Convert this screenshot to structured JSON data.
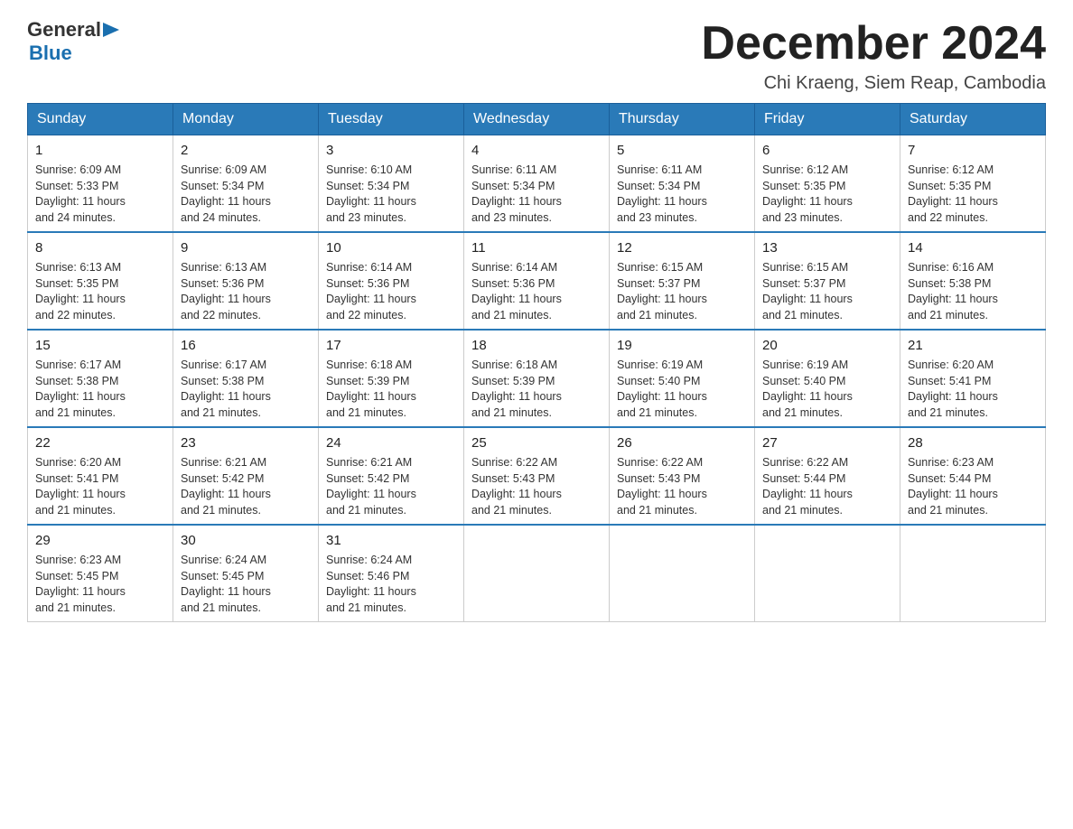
{
  "logo": {
    "general": "General",
    "blue": "Blue",
    "arrow": "▶"
  },
  "header": {
    "title": "December 2024",
    "subtitle": "Chi Kraeng, Siem Reap, Cambodia"
  },
  "days": [
    "Sunday",
    "Monday",
    "Tuesday",
    "Wednesday",
    "Thursday",
    "Friday",
    "Saturday"
  ],
  "weeks": [
    [
      {
        "date": "1",
        "sunrise": "6:09 AM",
        "sunset": "5:33 PM",
        "daylight": "11 hours and 24 minutes."
      },
      {
        "date": "2",
        "sunrise": "6:09 AM",
        "sunset": "5:34 PM",
        "daylight": "11 hours and 24 minutes."
      },
      {
        "date": "3",
        "sunrise": "6:10 AM",
        "sunset": "5:34 PM",
        "daylight": "11 hours and 23 minutes."
      },
      {
        "date": "4",
        "sunrise": "6:11 AM",
        "sunset": "5:34 PM",
        "daylight": "11 hours and 23 minutes."
      },
      {
        "date": "5",
        "sunrise": "6:11 AM",
        "sunset": "5:34 PM",
        "daylight": "11 hours and 23 minutes."
      },
      {
        "date": "6",
        "sunrise": "6:12 AM",
        "sunset": "5:35 PM",
        "daylight": "11 hours and 23 minutes."
      },
      {
        "date": "7",
        "sunrise": "6:12 AM",
        "sunset": "5:35 PM",
        "daylight": "11 hours and 22 minutes."
      }
    ],
    [
      {
        "date": "8",
        "sunrise": "6:13 AM",
        "sunset": "5:35 PM",
        "daylight": "11 hours and 22 minutes."
      },
      {
        "date": "9",
        "sunrise": "6:13 AM",
        "sunset": "5:36 PM",
        "daylight": "11 hours and 22 minutes."
      },
      {
        "date": "10",
        "sunrise": "6:14 AM",
        "sunset": "5:36 PM",
        "daylight": "11 hours and 22 minutes."
      },
      {
        "date": "11",
        "sunrise": "6:14 AM",
        "sunset": "5:36 PM",
        "daylight": "11 hours and 21 minutes."
      },
      {
        "date": "12",
        "sunrise": "6:15 AM",
        "sunset": "5:37 PM",
        "daylight": "11 hours and 21 minutes."
      },
      {
        "date": "13",
        "sunrise": "6:15 AM",
        "sunset": "5:37 PM",
        "daylight": "11 hours and 21 minutes."
      },
      {
        "date": "14",
        "sunrise": "6:16 AM",
        "sunset": "5:38 PM",
        "daylight": "11 hours and 21 minutes."
      }
    ],
    [
      {
        "date": "15",
        "sunrise": "6:17 AM",
        "sunset": "5:38 PM",
        "daylight": "11 hours and 21 minutes."
      },
      {
        "date": "16",
        "sunrise": "6:17 AM",
        "sunset": "5:38 PM",
        "daylight": "11 hours and 21 minutes."
      },
      {
        "date": "17",
        "sunrise": "6:18 AM",
        "sunset": "5:39 PM",
        "daylight": "11 hours and 21 minutes."
      },
      {
        "date": "18",
        "sunrise": "6:18 AM",
        "sunset": "5:39 PM",
        "daylight": "11 hours and 21 minutes."
      },
      {
        "date": "19",
        "sunrise": "6:19 AM",
        "sunset": "5:40 PM",
        "daylight": "11 hours and 21 minutes."
      },
      {
        "date": "20",
        "sunrise": "6:19 AM",
        "sunset": "5:40 PM",
        "daylight": "11 hours and 21 minutes."
      },
      {
        "date": "21",
        "sunrise": "6:20 AM",
        "sunset": "5:41 PM",
        "daylight": "11 hours and 21 minutes."
      }
    ],
    [
      {
        "date": "22",
        "sunrise": "6:20 AM",
        "sunset": "5:41 PM",
        "daylight": "11 hours and 21 minutes."
      },
      {
        "date": "23",
        "sunrise": "6:21 AM",
        "sunset": "5:42 PM",
        "daylight": "11 hours and 21 minutes."
      },
      {
        "date": "24",
        "sunrise": "6:21 AM",
        "sunset": "5:42 PM",
        "daylight": "11 hours and 21 minutes."
      },
      {
        "date": "25",
        "sunrise": "6:22 AM",
        "sunset": "5:43 PM",
        "daylight": "11 hours and 21 minutes."
      },
      {
        "date": "26",
        "sunrise": "6:22 AM",
        "sunset": "5:43 PM",
        "daylight": "11 hours and 21 minutes."
      },
      {
        "date": "27",
        "sunrise": "6:22 AM",
        "sunset": "5:44 PM",
        "daylight": "11 hours and 21 minutes."
      },
      {
        "date": "28",
        "sunrise": "6:23 AM",
        "sunset": "5:44 PM",
        "daylight": "11 hours and 21 minutes."
      }
    ],
    [
      {
        "date": "29",
        "sunrise": "6:23 AM",
        "sunset": "5:45 PM",
        "daylight": "11 hours and 21 minutes."
      },
      {
        "date": "30",
        "sunrise": "6:24 AM",
        "sunset": "5:45 PM",
        "daylight": "11 hours and 21 minutes."
      },
      {
        "date": "31",
        "sunrise": "6:24 AM",
        "sunset": "5:46 PM",
        "daylight": "11 hours and 21 minutes."
      },
      null,
      null,
      null,
      null
    ]
  ],
  "labels": {
    "sunrise": "Sunrise:",
    "sunset": "Sunset:",
    "daylight": "Daylight:"
  }
}
